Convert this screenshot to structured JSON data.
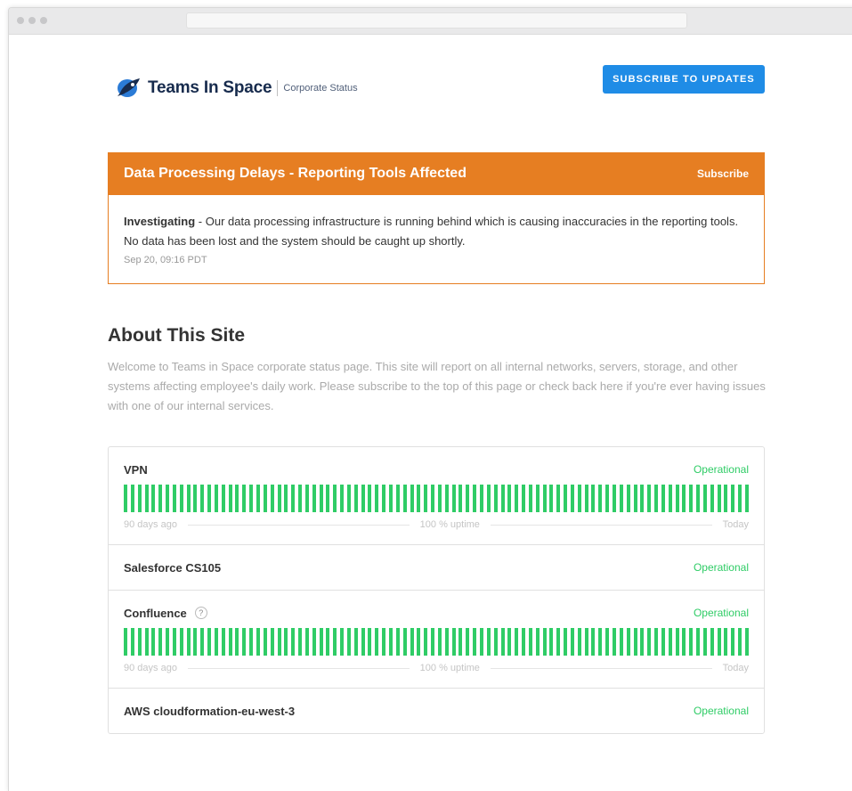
{
  "brand": {
    "name": "Teams In Space",
    "subtitle": "Corporate Status"
  },
  "header": {
    "subscribe_label": "SUBSCRIBE TO UPDATES"
  },
  "incident": {
    "title": "Data Processing Delays - Reporting Tools Affected",
    "subscribe_label": "Subscribe",
    "status": "Investigating",
    "message": " - Our data processing infrastructure is running behind which is causing inaccuracies in the reporting tools. No data has been lost and the system should be caught up shortly.",
    "timestamp": "Sep 20, 09:16 PDT",
    "color": "#e67e22"
  },
  "about": {
    "title": "About This Site",
    "text": "Welcome to Teams in Space corporate status page. This site will report on all internal networks, servers, storage, and other systems affecting employee's daily work. Please subscribe to the top of this page or check back here if you're ever having issues with one of our internal services."
  },
  "components": [
    {
      "name": "VPN",
      "status": "Operational",
      "has_bars": true,
      "legend_start": "90 days ago",
      "legend_mid": "100 % uptime",
      "legend_end": "Today",
      "uptime_percent": 100
    },
    {
      "name": "Salesforce CS105",
      "status": "Operational",
      "has_bars": false
    },
    {
      "name": "Confluence",
      "help_icon": "?",
      "status": "Operational",
      "has_bars": true,
      "legend_start": "90 days ago",
      "legend_mid": "100 % uptime",
      "legend_end": "Today",
      "uptime_percent": 100
    },
    {
      "name": "AWS cloudformation-eu-west-3",
      "status": "Operational",
      "has_bars": false
    }
  ],
  "colors": {
    "operational": "#2fcc66",
    "accent": "#1f8ce6",
    "incident": "#e67e22"
  }
}
